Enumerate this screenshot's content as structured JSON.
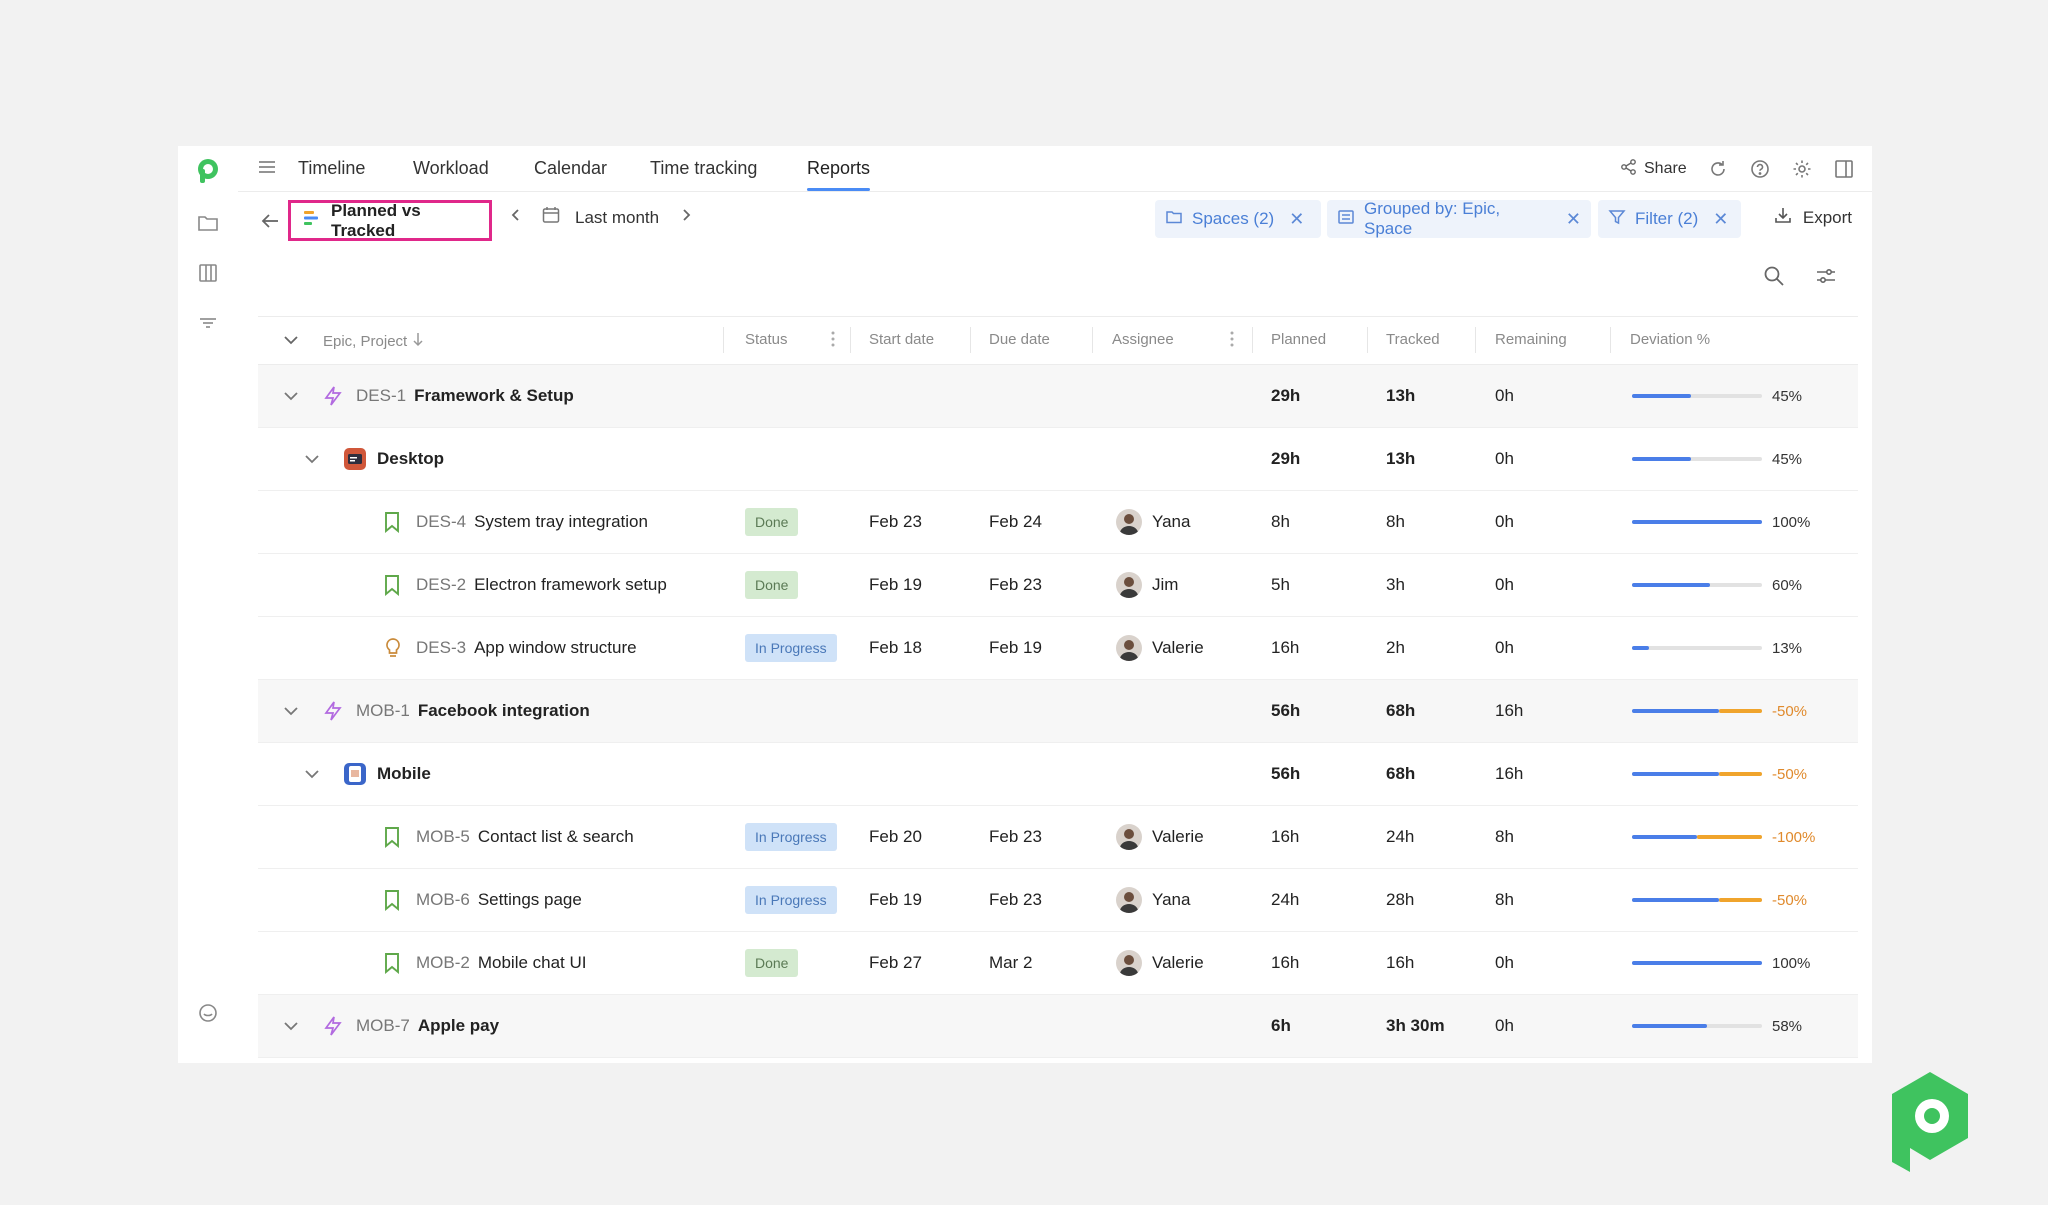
{
  "nav": {
    "tabs": [
      "Timeline",
      "Workload",
      "Calendar",
      "Time tracking",
      "Reports"
    ],
    "active_tab": "Reports",
    "share_label": "Share"
  },
  "toolbar": {
    "report_name": "Planned vs Tracked",
    "period": "Last month",
    "chips": [
      {
        "label": "Spaces (2)",
        "icon": "folder-icon"
      },
      {
        "label": "Grouped by: Epic, Space",
        "icon": "group-icon"
      },
      {
        "label": "Filter (2)",
        "icon": "filter-icon"
      }
    ],
    "export_label": "Export"
  },
  "table": {
    "headers": {
      "name": "Epic, Project",
      "status": "Status",
      "start": "Start date",
      "due": "Due date",
      "assignee": "Assignee",
      "planned": "Planned",
      "tracked": "Tracked",
      "remaining": "Remaining",
      "deviation": "Deviation %"
    },
    "rows": [
      {
        "level": "epic",
        "key": "DES-1",
        "title": "Framework & Setup",
        "status": "",
        "start": "",
        "due": "",
        "assignee": "",
        "planned": "29h",
        "tracked": "13h",
        "remaining": "0h",
        "progress": 0.45,
        "overrun": 0,
        "deviation": "45%"
      },
      {
        "level": "space",
        "key": "",
        "title": "Desktop",
        "status": "",
        "start": "",
        "due": "",
        "assignee": "",
        "planned": "29h",
        "tracked": "13h",
        "remaining": "0h",
        "progress": 0.45,
        "overrun": 0,
        "deviation": "45%"
      },
      {
        "level": "task",
        "icon": "bookmark-icon",
        "key": "DES-4",
        "title": "System tray integration",
        "status": "Done",
        "start": "Feb 23",
        "due": "Feb 24",
        "assignee": "Yana",
        "planned": "8h",
        "tracked": "8h",
        "remaining": "0h",
        "progress": 1.0,
        "overrun": 0,
        "deviation": "100%"
      },
      {
        "level": "task",
        "icon": "bookmark-icon",
        "key": "DES-2",
        "title": "Electron framework setup",
        "status": "Done",
        "start": "Feb 19",
        "due": "Feb 23",
        "assignee": "Jim",
        "planned": "5h",
        "tracked": "3h",
        "remaining": "0h",
        "progress": 0.6,
        "overrun": 0,
        "deviation": "60%"
      },
      {
        "level": "task",
        "icon": "bulb-icon",
        "key": "DES-3",
        "title": "App window structure",
        "status": "In Progress",
        "start": "Feb 18",
        "due": "Feb 19",
        "assignee": "Valerie",
        "planned": "16h",
        "tracked": "2h",
        "remaining": "0h",
        "progress": 0.13,
        "overrun": 0,
        "deviation": "13%"
      },
      {
        "level": "epic",
        "key": "MOB-1",
        "title": "Facebook integration",
        "status": "",
        "start": "",
        "due": "",
        "assignee": "",
        "planned": "56h",
        "tracked": "68h",
        "remaining": "16h",
        "progress": 0.67,
        "overrun": 0.33,
        "deviation": "-50%"
      },
      {
        "level": "space",
        "key": "",
        "title": "Mobile",
        "status": "",
        "start": "",
        "due": "",
        "assignee": "",
        "planned": "56h",
        "tracked": "68h",
        "remaining": "16h",
        "progress": 0.67,
        "overrun": 0.33,
        "deviation": "-50%"
      },
      {
        "level": "task",
        "icon": "bookmark-icon",
        "key": "MOB-5",
        "title": "Contact list & search",
        "status": "In Progress",
        "start": "Feb 20",
        "due": "Feb 23",
        "assignee": "Valerie",
        "planned": "16h",
        "tracked": "24h",
        "remaining": "8h",
        "progress": 0.5,
        "overrun": 0.5,
        "deviation": "-100%"
      },
      {
        "level": "task",
        "icon": "bookmark-icon",
        "key": "MOB-6",
        "title": "Settings page",
        "status": "In Progress",
        "start": "Feb 19",
        "due": "Feb 23",
        "assignee": "Yana",
        "planned": "24h",
        "tracked": "28h",
        "remaining": "8h",
        "progress": 0.67,
        "overrun": 0.33,
        "deviation": "-50%"
      },
      {
        "level": "task",
        "icon": "bookmark-icon",
        "key": "MOB-2",
        "title": "Mobile chat UI",
        "status": "Done",
        "start": "Feb 27",
        "due": "Mar 2",
        "assignee": "Valerie",
        "planned": "16h",
        "tracked": "16h",
        "remaining": "0h",
        "progress": 1.0,
        "overrun": 0,
        "deviation": "100%"
      },
      {
        "level": "epic",
        "key": "MOB-7",
        "title": "Apple pay",
        "status": "",
        "start": "",
        "due": "",
        "assignee": "",
        "planned": "6h",
        "tracked": "3h 30m",
        "remaining": "0h",
        "progress": 0.58,
        "overrun": 0,
        "deviation": "58%"
      }
    ]
  },
  "colors": {
    "accent": "#4a8bf5",
    "brand": "#3fc35f",
    "highlight": "#e0288a",
    "bar_blue": "#4a7ee8",
    "bar_orange": "#f0a42c",
    "done_bg": "#d4ead0",
    "progress_bg": "#cfe2f8"
  }
}
